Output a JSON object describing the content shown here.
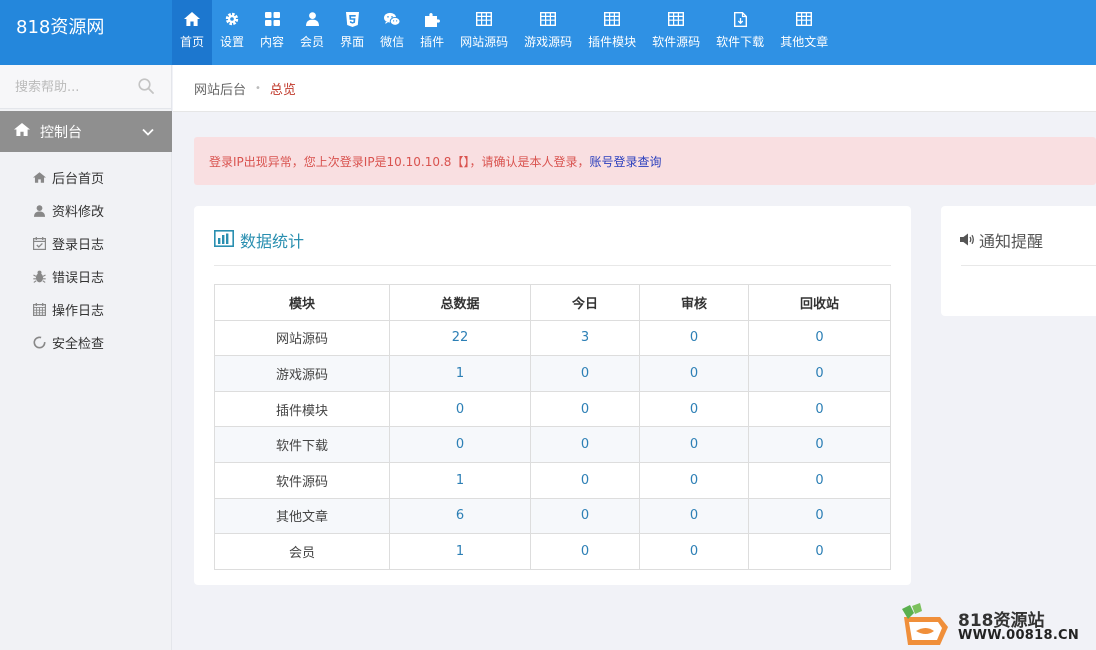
{
  "brand": "818资源网",
  "nav": [
    {
      "label": "首页",
      "icon": "home-icon"
    },
    {
      "label": "设置",
      "icon": "gear-icon"
    },
    {
      "label": "内容",
      "icon": "grid-icon"
    },
    {
      "label": "会员",
      "icon": "user-icon"
    },
    {
      "label": "界面",
      "icon": "html5-icon"
    },
    {
      "label": "微信",
      "icon": "wechat-icon"
    },
    {
      "label": "插件",
      "icon": "puzzle-icon"
    },
    {
      "label": "网站源码",
      "icon": "table-icon"
    },
    {
      "label": "游戏源码",
      "icon": "table-icon"
    },
    {
      "label": "插件模块",
      "icon": "table-icon"
    },
    {
      "label": "软件源码",
      "icon": "table-icon"
    },
    {
      "label": "软件下载",
      "icon": "file-icon"
    },
    {
      "label": "其他文章",
      "icon": "table-icon"
    }
  ],
  "sidebar": {
    "search_placeholder": "搜索帮助...",
    "section_title": "控制台",
    "items": [
      {
        "label": "后台首页",
        "icon": "home-icon"
      },
      {
        "label": "资料修改",
        "icon": "user-icon"
      },
      {
        "label": "登录日志",
        "icon": "calendar-check-icon"
      },
      {
        "label": "错误日志",
        "icon": "bug-icon"
      },
      {
        "label": "操作日志",
        "icon": "calendar-icon"
      },
      {
        "label": "安全检查",
        "icon": "spinner-icon"
      }
    ]
  },
  "breadcrumb": {
    "root": "网站后台",
    "sep": "•",
    "current": "总览"
  },
  "alert": {
    "text": "登录IP出现异常，您上次登录IP是10.10.10.8【】，请确认是本人登录，",
    "link": "账号登录查询"
  },
  "stats": {
    "title": "数据统计",
    "columns": [
      "模块",
      "总数据",
      "今日",
      "审核",
      "回收站"
    ],
    "rows": [
      [
        "网站源码",
        "22",
        "3",
        "0",
        "0"
      ],
      [
        "游戏源码",
        "1",
        "0",
        "0",
        "0"
      ],
      [
        "插件模块",
        "0",
        "0",
        "0",
        "0"
      ],
      [
        "软件下载",
        "0",
        "0",
        "0",
        "0"
      ],
      [
        "软件源码",
        "1",
        "0",
        "0",
        "0"
      ],
      [
        "其他文章",
        "6",
        "0",
        "0",
        "0"
      ],
      [
        "会员",
        "1",
        "0",
        "0",
        "0"
      ]
    ]
  },
  "notice": {
    "title": "通知提醒"
  },
  "watermark": {
    "line1": "818资源站",
    "line2": "WWW.00818.CN"
  },
  "colors": {
    "accent": "#2f91e4",
    "alert_bg": "#f9dfe1",
    "alert_text": "#d9534f",
    "link": "#2a3fbd",
    "number": "#2c7fb5"
  }
}
